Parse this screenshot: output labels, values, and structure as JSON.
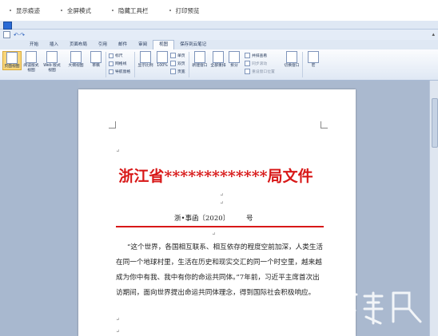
{
  "topbar": {
    "items": [
      "显示痕迹",
      "全屏模式",
      "隐藏工具栏",
      "打印预览"
    ]
  },
  "qat": {
    "undo": "↶·↷"
  },
  "ribbon_tabs": [
    "开始",
    "插入",
    "页面布局",
    "引用",
    "邮件",
    "审阅",
    "视图",
    "保存到云笔记"
  ],
  "active_tab": "视图",
  "ribbon": {
    "views": [
      "页面视图",
      "阅读版式视图",
      "Web 版式视图",
      "大纲视图",
      "草稿"
    ],
    "show": [
      "标尺",
      "网格线",
      "导航窗格"
    ],
    "zoom": [
      "显示比例",
      "100%"
    ],
    "pages": [
      "单页",
      "双页",
      "页宽"
    ],
    "window": [
      "新建窗口",
      "全部重排",
      "拆分"
    ],
    "window_small": [
      "并排查看",
      "同步滚动",
      "重设窗口位置"
    ],
    "switch": "切换窗口",
    "macro": "宏"
  },
  "doc": {
    "title": "浙江省*************局文件",
    "number": "浙•事函〔2020〕",
    "number_unit": "号",
    "paragraph": "“这个世界，各国相互联系、相互依存的程度空前加深，人类生活在同一个地球村里，生活在历史和现实交汇的同一个时空里，越来越成为你中有我、我中有你的命运共同体。”7年前，习近平主席首次出访期间，面向世界提出命运共同体理念，得到国际社会积极响应。",
    "para_mark": "↵"
  },
  "watermark": "下载吧",
  "colors": {
    "accent_red": "#d81818",
    "ribbon_blue": "#dfe8f4"
  }
}
